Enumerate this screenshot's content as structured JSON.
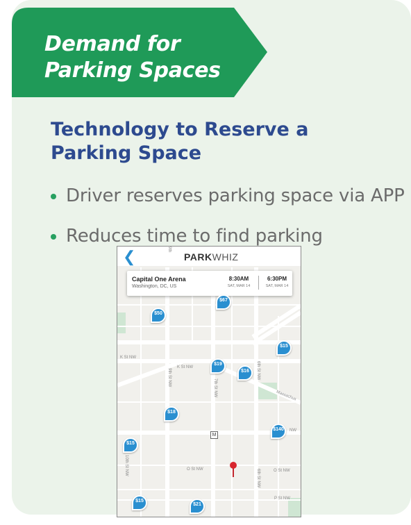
{
  "banner": {
    "title": "Demand for\nParking Spaces",
    "color": "#1f9a58"
  },
  "section": {
    "heading": "Technology to Reserve a Parking Space",
    "bullets": [
      "Driver reserves parking space via APP",
      "Reduces time to find parking"
    ]
  },
  "app": {
    "back_icon": "chevron-left-icon",
    "brand_bold": "PARK",
    "brand_light": "WHIZ",
    "event": {
      "name": "Capital One Arena",
      "location": "Washington, DC, US",
      "start_time": "8:30AM",
      "start_date": "SAT, MAR 14",
      "end_time": "6:30PM",
      "end_date": "SAT, MAR 14"
    },
    "streets": {
      "k_st_left": "K St NW",
      "k_st": "K St NW",
      "ninth": "9th St NW",
      "seventh": "7th St NW",
      "sixth_top": "6th St NW",
      "sixth_bottom": "6th St NW",
      "tenth": "10th St NW",
      "o_st": "O St NW",
      "o_st_right": "O St NW",
      "p_st": "P St NW",
      "mass": "Massachus",
      "nw_suffix": "NW",
      "ninth_top": "9th"
    },
    "metro_label": "M",
    "prices": [
      "$50",
      "$67",
      "$15",
      "$19",
      "$16",
      "$18",
      "$140",
      "$15",
      "$15",
      "$21"
    ],
    "accent": "#2a8fd0",
    "destination_icon": "red-map-pin-icon"
  }
}
